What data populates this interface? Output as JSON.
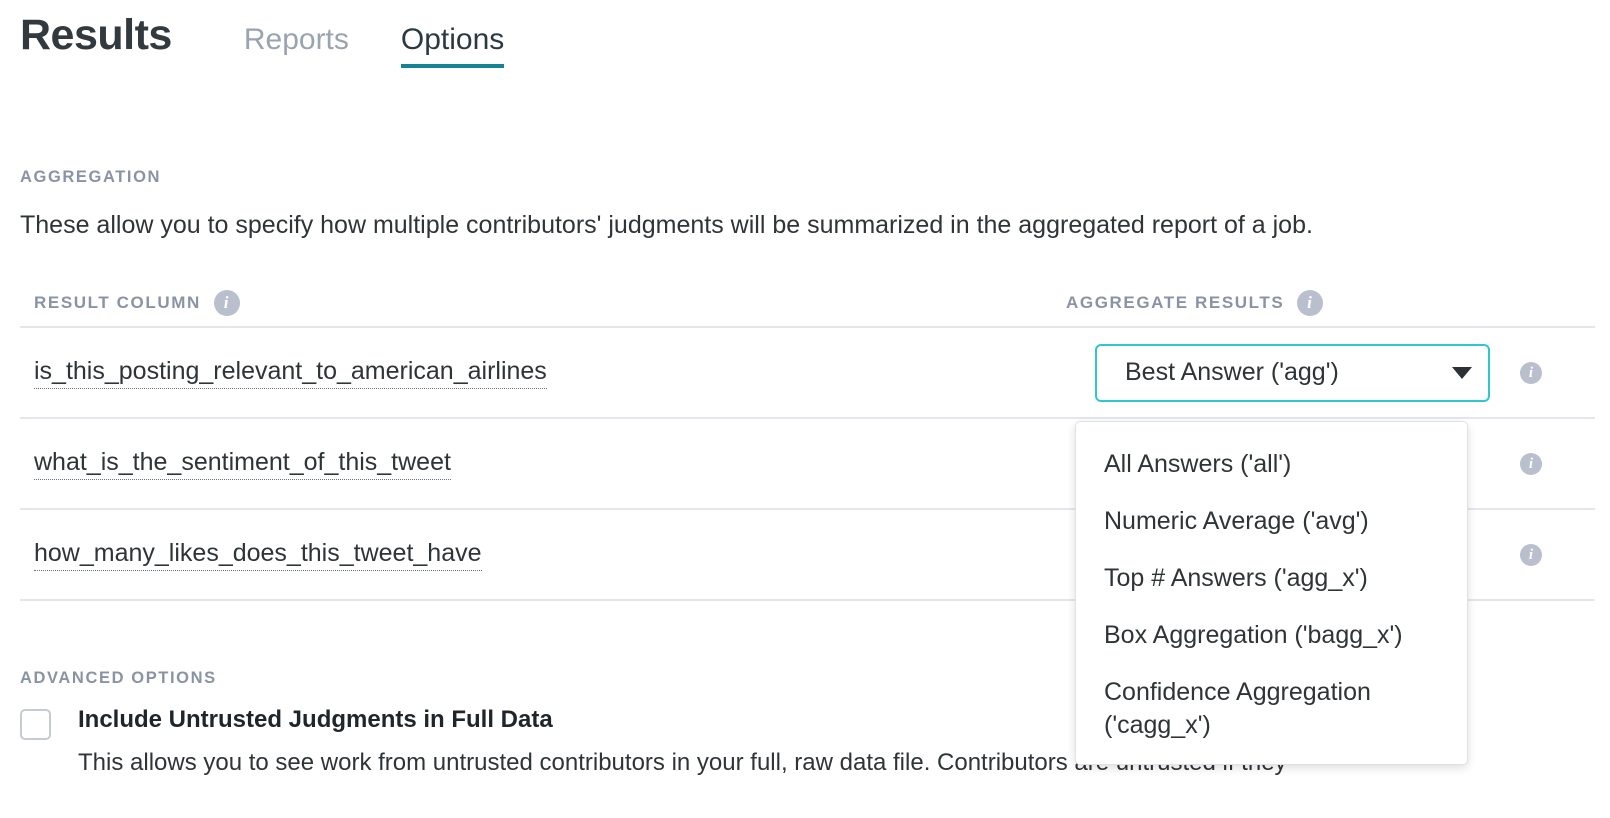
{
  "header": {
    "title": "Results",
    "tabs": [
      {
        "label": "Reports",
        "active": false
      },
      {
        "label": "Options",
        "active": true
      }
    ]
  },
  "aggregation": {
    "section_label": "AGGREGATION",
    "description": "These allow you to specify how multiple contributors' judgments will be summarized in the aggregated report of a job.",
    "columns": {
      "result_column": "RESULT COLUMN",
      "aggregate_results": "AGGREGATE RESULTS"
    },
    "info_icon": "info-icon",
    "rows": [
      {
        "label": "is_this_posting_relevant_to_american_airlines",
        "selected_value": "Best Answer ('agg')",
        "open": true
      },
      {
        "label": "what_is_the_sentiment_of_this_tweet",
        "selected_value": "",
        "open": false
      },
      {
        "label": "how_many_likes_does_this_tweet_have",
        "selected_value": "",
        "open": false
      }
    ],
    "dropdown_options": [
      "All Answers ('all')",
      "Numeric Average ('avg')",
      "Top # Answers ('agg_x')",
      "Box Aggregation ('bagg_x')",
      "Confidence Aggregation ('cagg_x')"
    ]
  },
  "advanced_options": {
    "section_label": "ADVANCED OPTIONS",
    "checkbox_label": "Include Untrusted Judgments in Full Data",
    "checkbox_checked": false,
    "description": "This allows you to see work from untrusted contributors in your full, raw data file. Contributors are untrusted if they"
  },
  "colors": {
    "accent_teal": "#138496",
    "select_border": "#2ec7cf",
    "label_gray": "#8a93a5",
    "text_dark": "#2f3437",
    "divider": "#e3e6ea"
  }
}
